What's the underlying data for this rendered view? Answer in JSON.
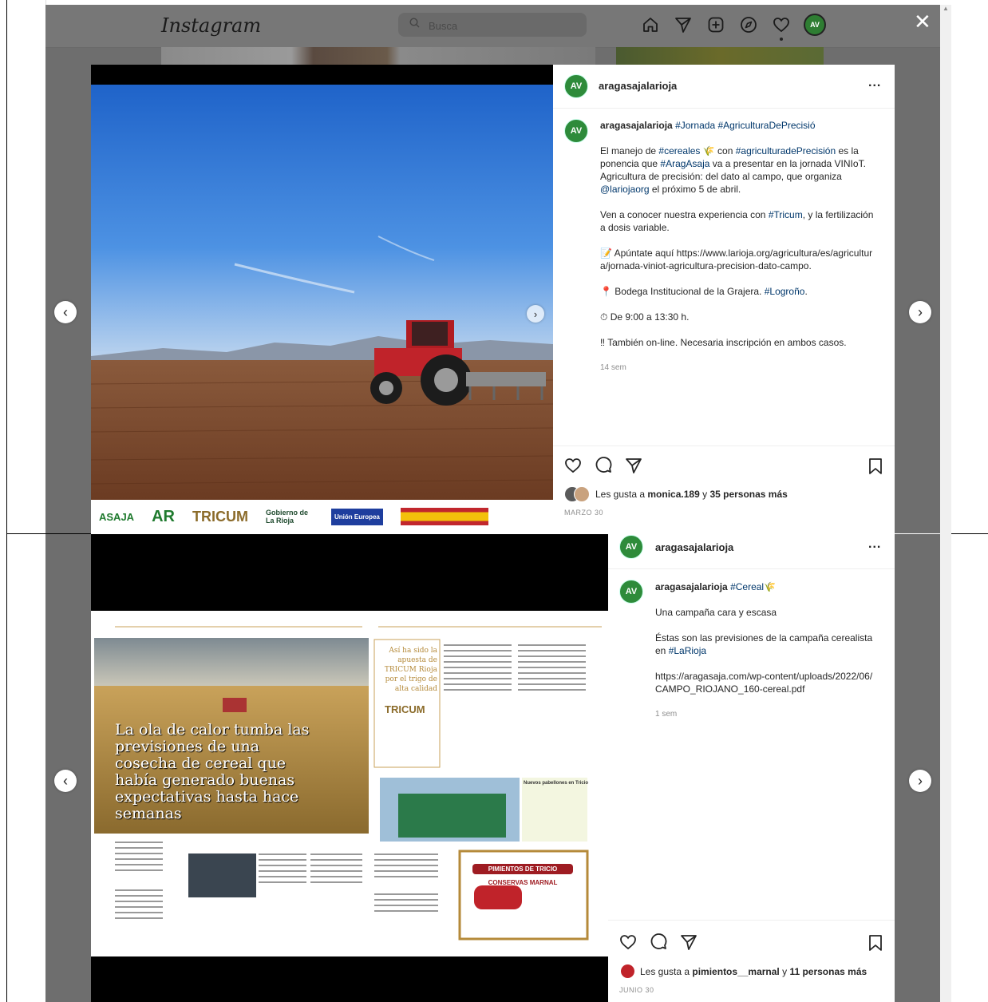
{
  "app": {
    "logo": "Instagram",
    "search_placeholder": "Busca",
    "avatar_initials": "AV",
    "close": "✕"
  },
  "nav_icons": [
    "home-icon",
    "send-icon",
    "new-post-icon",
    "explore-icon",
    "activity-heart-icon",
    "profile-avatar"
  ],
  "colors": {
    "accent": "#2e8b3a",
    "link": "#00376b",
    "overlay": "#6e6e6e"
  },
  "post1": {
    "username": "aragasajalarioja",
    "more": "...",
    "caption_user": "aragasajalarioja",
    "caption_tags": "#Jornada #AgriculturaDePrecisió",
    "p1_a": "El manejo de ",
    "p1_tag1": "#cereales",
    "p1_b": " 🌾  con ",
    "p1_tag2": "#agriculturadePrecisión",
    "p1_c": " es la ponencia que ",
    "p1_tag3": "#AragAsaja",
    "p1_d": " va a presentar en la jornada VINIoT. Agricultura de precisión: del dato al campo,  que organiza ",
    "p1_tag4": "@lariojaorg",
    "p1_e": " el próximo 5 de abril.",
    "p2_a": "Ven a conocer nuestra experiencia con ",
    "p2_tag": "#Tricum",
    "p2_b": ", y la fertilización a dosis variable.",
    "p3": "📝 Apúntate aquí https://www.larioja.org/agricultura/es/agricultura/jornada-viniot-agricultura-precision-dato-campo.",
    "p4_a": "📍 Bodega Institucional de la Grajera. ",
    "p4_tag": "#Logroño",
    "p4_b": ".",
    "p5": "⏱ De 9:00 a 13:30 h.",
    "p6": "‼ También on-line. Necesaria inscripción en ambos casos.",
    "time": "14 sem",
    "likes_prefix": "Les gusta a ",
    "likes_user": "monica.189",
    "likes_mid": " y ",
    "likes_count": "35 personas más",
    "date": "MARZO 30",
    "logos": [
      "ASAJA",
      "AR",
      "TRICUM",
      "Gobierno de La Rioja",
      "Unión Europea"
    ]
  },
  "post2": {
    "username": "aragasajalarioja",
    "more": "...",
    "caption_user": "aragasajalarioja",
    "caption_tag": "#Cereal",
    "caption_emoji": "🌾",
    "p1": "Una campaña cara y escasa",
    "p2_a": "Éstas son las previsiones de la campaña cerealista en ",
    "p2_tag": "#LaRioja",
    "p3": "https://aragasaja.com/wp-content/uploads/2022/06/CAMPO_RIOJANO_160-cereal.pdf",
    "time": "1 sem",
    "likes_prefix": "Les gusta a ",
    "likes_user": "pimientos__marnal",
    "likes_mid": " y ",
    "likes_count": "11 personas más",
    "date": "JUNIO 30",
    "article": {
      "headline": "La ola de calor tumba las previsiones de una cosecha de cereal que había generado buenas expectativas hasta hace semanas",
      "side_title": "Así ha sido la apuesta de TRICUM Rioja por el trigo de alta calidad",
      "side_logo": "TRICUM",
      "box_title": "Nuevos pabellones en Tricio",
      "ad_title": "PIMIENTOS DE TRICIO",
      "ad_sub": "CONSERVAS MARNAL"
    }
  }
}
